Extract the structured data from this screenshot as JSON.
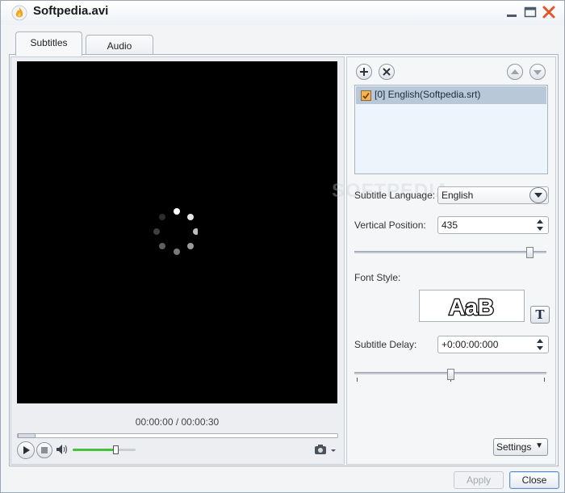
{
  "window": {
    "title": "Softpedia.avi"
  },
  "tabs": [
    {
      "label": "Subtitles",
      "active": true
    },
    {
      "label": "Audio",
      "active": false
    }
  ],
  "player": {
    "time": "00:00:00 / 00:00:30",
    "seek_progress": 0.0,
    "volume_level": 0.68
  },
  "subtitles": {
    "items": [
      {
        "label": "[0] English(Softpedia.srt)",
        "checked": true,
        "selected": true
      }
    ],
    "language_label": "Subtitle Language:",
    "language_value": "English",
    "vertical_position_label": "Vertical Position:",
    "vertical_position_value": "435",
    "vertical_position_slider": 0.91,
    "font_style_label": "Font Style:",
    "font_preview_text": "AaB",
    "font_button_glyph": "T",
    "delay_label": "Subtitle Delay:",
    "delay_value": "+0:00:00:000",
    "delay_slider": 0.5
  },
  "buttons": {
    "settings": "Settings",
    "apply": "Apply",
    "close": "Close"
  },
  "watermark": "SOFTPEDIA",
  "colors": {
    "volume_fill": "#45c23a",
    "selected_row": "#b9c8d8",
    "checkbox": "#f7b34c",
    "close_icon": "#e0552a"
  },
  "icons": {
    "app": "flame-app-icon",
    "minimize": "minimize-icon",
    "maximize": "maximize-icon",
    "close": "close-x-icon",
    "add": "plus-icon",
    "remove": "x-icon",
    "move_up": "arrow-up-icon",
    "move_down": "arrow-down-icon",
    "play": "play-icon",
    "stop": "stop-icon",
    "volume": "speaker-icon",
    "camera": "camera-icon"
  }
}
